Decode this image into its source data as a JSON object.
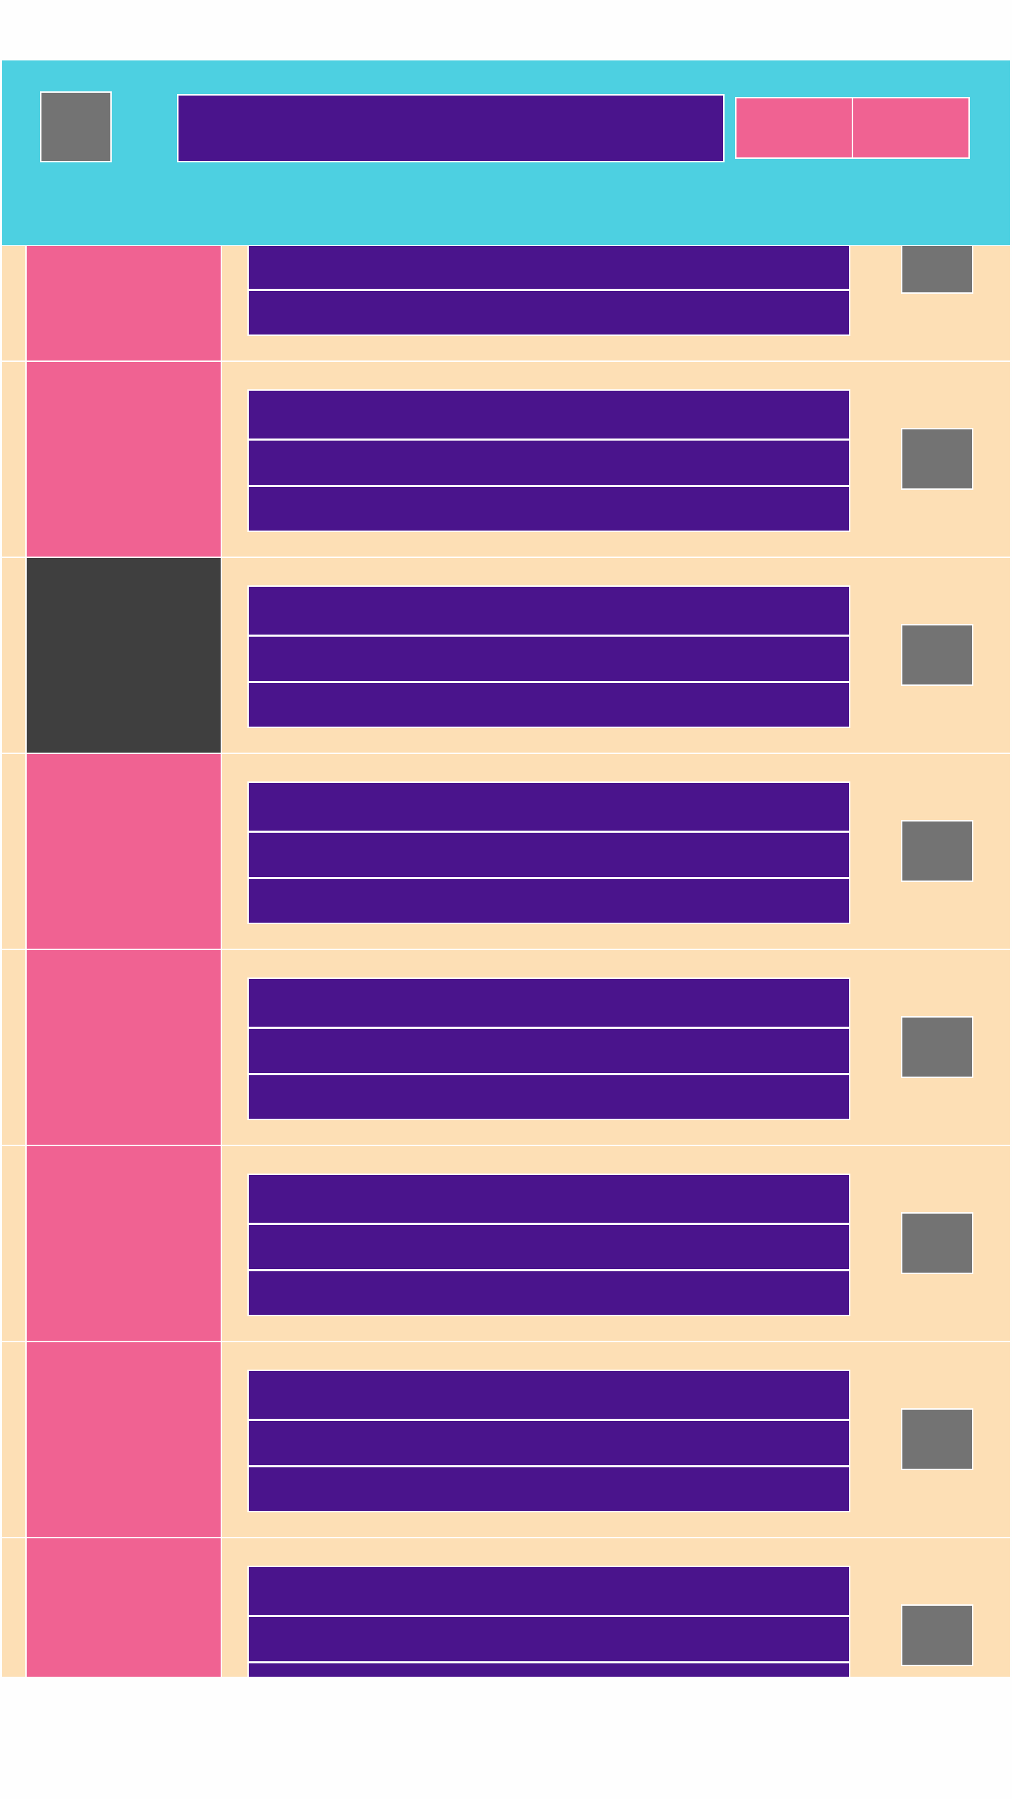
{
  "colors": {
    "header_bg": "#4DD0E1",
    "row_bg": "#FDDFB5",
    "text_block": "#4A148C",
    "accent": "#F06292",
    "icon": "#737373",
    "thumb_dark": "#3F3F3F"
  },
  "header": {
    "logo_icon": "image-placeholder-icon",
    "search_placeholder": "",
    "buttons": [
      {
        "icon": "action-button"
      },
      {
        "icon": "action-button"
      }
    ]
  },
  "list": {
    "rows": [
      {
        "thumb": "accent",
        "lines": 3
      },
      {
        "thumb": "accent",
        "lines": 3
      },
      {
        "thumb": "thumb_dark",
        "lines": 3
      },
      {
        "thumb": "accent",
        "lines": 3
      },
      {
        "thumb": "accent",
        "lines": 3
      },
      {
        "thumb": "accent",
        "lines": 3
      },
      {
        "thumb": "accent",
        "lines": 3
      },
      {
        "thumb": "accent",
        "lines": 3
      }
    ]
  }
}
